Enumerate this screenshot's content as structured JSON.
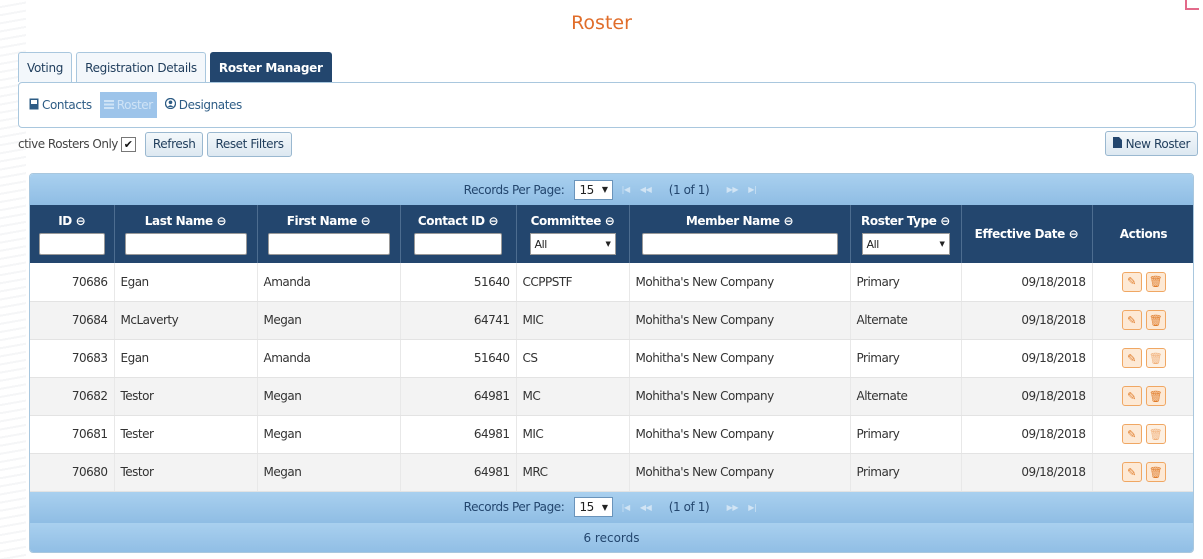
{
  "page": {
    "title": "Roster"
  },
  "tabs": [
    {
      "label": "Voting"
    },
    {
      "label": "Registration Details"
    },
    {
      "label": "Roster Manager"
    }
  ],
  "subtabs": [
    {
      "label": "Contacts",
      "icon": "contact-card-icon"
    },
    {
      "label": "Roster",
      "icon": "list-icon"
    },
    {
      "label": "Designates",
      "icon": "user-icon"
    }
  ],
  "filters": {
    "active_only_label": "ctive Rosters Only",
    "active_only_checked": true,
    "refresh_label": "Refresh",
    "reset_label": "Reset Filters",
    "new_roster_label": "New Roster"
  },
  "pager": {
    "records_per_page_label": "Records Per Page:",
    "per_page": "15",
    "page_info": "(1 of 1)"
  },
  "columns": {
    "id": "ID ⊖",
    "last_name": "Last Name ⊖",
    "first_name": "First Name ⊖",
    "contact_id": "Contact ID ⊖",
    "committee": "Committee ⊖",
    "member_name": "Member Name ⊖",
    "roster_type": "Roster Type ⊖",
    "effective_date": "Effective Date ⊖",
    "actions": "Actions"
  },
  "column_filters": {
    "committee_value": "All",
    "roster_type_value": "All"
  },
  "rows": [
    {
      "id": "70686",
      "last_name": "Egan",
      "first_name": "Amanda",
      "contact_id": "51640",
      "committee": "CCPPSTF",
      "member_name": "Mohitha's New Company",
      "roster_type": "Primary",
      "effective_date": "09/18/2018"
    },
    {
      "id": "70684",
      "last_name": "McLaverty",
      "first_name": "Megan",
      "contact_id": "64741",
      "committee": "MIC",
      "member_name": "Mohitha's New Company",
      "roster_type": "Alternate",
      "effective_date": "09/18/2018"
    },
    {
      "id": "70683",
      "last_name": "Egan",
      "first_name": "Amanda",
      "contact_id": "51640",
      "committee": "CS",
      "member_name": "Mohitha's New Company",
      "roster_type": "Primary",
      "effective_date": "09/18/2018"
    },
    {
      "id": "70682",
      "last_name": "Testor",
      "first_name": "Megan",
      "contact_id": "64981",
      "committee": "MC",
      "member_name": "Mohitha's New Company",
      "roster_type": "Alternate",
      "effective_date": "09/18/2018"
    },
    {
      "id": "70681",
      "last_name": "Tester",
      "first_name": "Megan",
      "contact_id": "64981",
      "committee": "MIC",
      "member_name": "Mohitha's New Company",
      "roster_type": "Primary",
      "effective_date": "09/18/2018"
    },
    {
      "id": "70680",
      "last_name": "Testor",
      "first_name": "Megan",
      "contact_id": "64981",
      "committee": "MRC",
      "member_name": "Mohitha's New Company",
      "roster_type": "Primary",
      "effective_date": "09/18/2018"
    }
  ],
  "footer": {
    "records_count": "6 records"
  },
  "colors": {
    "accent": "#e06d2a",
    "header_bg": "#23466e",
    "pager_bg": "#9cc8ea"
  }
}
